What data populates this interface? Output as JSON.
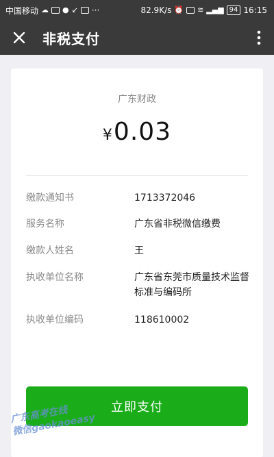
{
  "status_bar": {
    "carrier": "中国移动",
    "network_speed": "82.9K/s",
    "battery": "94",
    "time": "16:15",
    "overflow": "···"
  },
  "navbar": {
    "title": "非税支付",
    "close_icon": "close-icon",
    "more_icon": "more-vertical-icon"
  },
  "payment": {
    "payee": "广东财政",
    "currency_symbol": "¥",
    "amount": "0.03"
  },
  "details": [
    {
      "label": "缴款通知书",
      "value": "1713372046"
    },
    {
      "label": "服务名称",
      "value": "广东省非税微信缴费"
    },
    {
      "label": "缴款人姓名",
      "value": "王"
    },
    {
      "label": "执收单位名称",
      "value": "广东省东莞市质量技术监督标准与编码所"
    },
    {
      "label": "执收单位编码",
      "value": "118610002"
    }
  ],
  "pay_button": {
    "label": "立即支付"
  },
  "watermark": {
    "line1": "广东高考在线",
    "line2": "微信gaokaoeasy"
  },
  "colors": {
    "bar_background": "#3a3a3a",
    "page_background": "#efeff4",
    "primary_button": "#1aad19"
  }
}
